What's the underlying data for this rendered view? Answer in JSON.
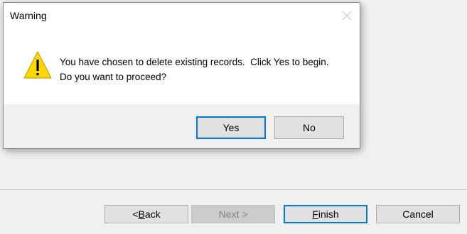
{
  "wizard": {
    "buttons": {
      "back": {
        "mnemonic": "B",
        "rest": "ack",
        "prefix": "< "
      },
      "next": {
        "label": "Next >"
      },
      "finish": {
        "mnemonic": "F",
        "rest": "inish"
      },
      "cancel": {
        "label": "Cancel"
      }
    }
  },
  "dialog": {
    "title": "Warning",
    "icon": "warning-triangle-icon",
    "message_lines": [
      "You have chosen to delete existing records.  Click Yes to begin.",
      "Do you want to proceed?"
    ],
    "buttons": {
      "yes": "Yes",
      "no": "No"
    }
  },
  "colors": {
    "accent": "#0078d7",
    "warning_fill": "#ffd800",
    "window_bg": "#f0f0f0"
  }
}
